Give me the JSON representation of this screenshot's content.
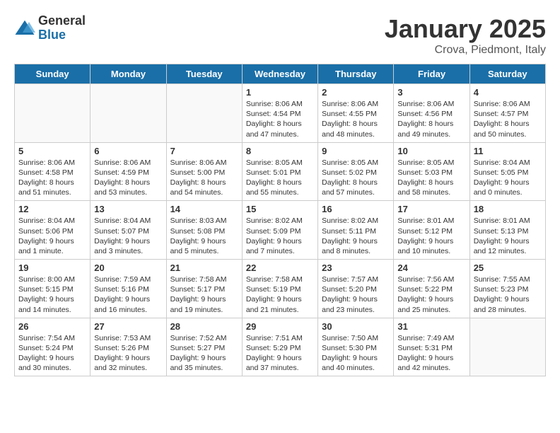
{
  "logo": {
    "general": "General",
    "blue": "Blue"
  },
  "title": {
    "month": "January 2025",
    "location": "Crova, Piedmont, Italy"
  },
  "days_of_week": [
    "Sunday",
    "Monday",
    "Tuesday",
    "Wednesday",
    "Thursday",
    "Friday",
    "Saturday"
  ],
  "weeks": [
    [
      {
        "day": "",
        "content": ""
      },
      {
        "day": "",
        "content": ""
      },
      {
        "day": "",
        "content": ""
      },
      {
        "day": "1",
        "content": "Sunrise: 8:06 AM\nSunset: 4:54 PM\nDaylight: 8 hours and 47 minutes."
      },
      {
        "day": "2",
        "content": "Sunrise: 8:06 AM\nSunset: 4:55 PM\nDaylight: 8 hours and 48 minutes."
      },
      {
        "day": "3",
        "content": "Sunrise: 8:06 AM\nSunset: 4:56 PM\nDaylight: 8 hours and 49 minutes."
      },
      {
        "day": "4",
        "content": "Sunrise: 8:06 AM\nSunset: 4:57 PM\nDaylight: 8 hours and 50 minutes."
      }
    ],
    [
      {
        "day": "5",
        "content": "Sunrise: 8:06 AM\nSunset: 4:58 PM\nDaylight: 8 hours and 51 minutes."
      },
      {
        "day": "6",
        "content": "Sunrise: 8:06 AM\nSunset: 4:59 PM\nDaylight: 8 hours and 53 minutes."
      },
      {
        "day": "7",
        "content": "Sunrise: 8:06 AM\nSunset: 5:00 PM\nDaylight: 8 hours and 54 minutes."
      },
      {
        "day": "8",
        "content": "Sunrise: 8:05 AM\nSunset: 5:01 PM\nDaylight: 8 hours and 55 minutes."
      },
      {
        "day": "9",
        "content": "Sunrise: 8:05 AM\nSunset: 5:02 PM\nDaylight: 8 hours and 57 minutes."
      },
      {
        "day": "10",
        "content": "Sunrise: 8:05 AM\nSunset: 5:03 PM\nDaylight: 8 hours and 58 minutes."
      },
      {
        "day": "11",
        "content": "Sunrise: 8:04 AM\nSunset: 5:05 PM\nDaylight: 9 hours and 0 minutes."
      }
    ],
    [
      {
        "day": "12",
        "content": "Sunrise: 8:04 AM\nSunset: 5:06 PM\nDaylight: 9 hours and 1 minute."
      },
      {
        "day": "13",
        "content": "Sunrise: 8:04 AM\nSunset: 5:07 PM\nDaylight: 9 hours and 3 minutes."
      },
      {
        "day": "14",
        "content": "Sunrise: 8:03 AM\nSunset: 5:08 PM\nDaylight: 9 hours and 5 minutes."
      },
      {
        "day": "15",
        "content": "Sunrise: 8:02 AM\nSunset: 5:09 PM\nDaylight: 9 hours and 7 minutes."
      },
      {
        "day": "16",
        "content": "Sunrise: 8:02 AM\nSunset: 5:11 PM\nDaylight: 9 hours and 8 minutes."
      },
      {
        "day": "17",
        "content": "Sunrise: 8:01 AM\nSunset: 5:12 PM\nDaylight: 9 hours and 10 minutes."
      },
      {
        "day": "18",
        "content": "Sunrise: 8:01 AM\nSunset: 5:13 PM\nDaylight: 9 hours and 12 minutes."
      }
    ],
    [
      {
        "day": "19",
        "content": "Sunrise: 8:00 AM\nSunset: 5:15 PM\nDaylight: 9 hours and 14 minutes."
      },
      {
        "day": "20",
        "content": "Sunrise: 7:59 AM\nSunset: 5:16 PM\nDaylight: 9 hours and 16 minutes."
      },
      {
        "day": "21",
        "content": "Sunrise: 7:58 AM\nSunset: 5:17 PM\nDaylight: 9 hours and 19 minutes."
      },
      {
        "day": "22",
        "content": "Sunrise: 7:58 AM\nSunset: 5:19 PM\nDaylight: 9 hours and 21 minutes."
      },
      {
        "day": "23",
        "content": "Sunrise: 7:57 AM\nSunset: 5:20 PM\nDaylight: 9 hours and 23 minutes."
      },
      {
        "day": "24",
        "content": "Sunrise: 7:56 AM\nSunset: 5:22 PM\nDaylight: 9 hours and 25 minutes."
      },
      {
        "day": "25",
        "content": "Sunrise: 7:55 AM\nSunset: 5:23 PM\nDaylight: 9 hours and 28 minutes."
      }
    ],
    [
      {
        "day": "26",
        "content": "Sunrise: 7:54 AM\nSunset: 5:24 PM\nDaylight: 9 hours and 30 minutes."
      },
      {
        "day": "27",
        "content": "Sunrise: 7:53 AM\nSunset: 5:26 PM\nDaylight: 9 hours and 32 minutes."
      },
      {
        "day": "28",
        "content": "Sunrise: 7:52 AM\nSunset: 5:27 PM\nDaylight: 9 hours and 35 minutes."
      },
      {
        "day": "29",
        "content": "Sunrise: 7:51 AM\nSunset: 5:29 PM\nDaylight: 9 hours and 37 minutes."
      },
      {
        "day": "30",
        "content": "Sunrise: 7:50 AM\nSunset: 5:30 PM\nDaylight: 9 hours and 40 minutes."
      },
      {
        "day": "31",
        "content": "Sunrise: 7:49 AM\nSunset: 5:31 PM\nDaylight: 9 hours and 42 minutes."
      },
      {
        "day": "",
        "content": ""
      }
    ]
  ]
}
